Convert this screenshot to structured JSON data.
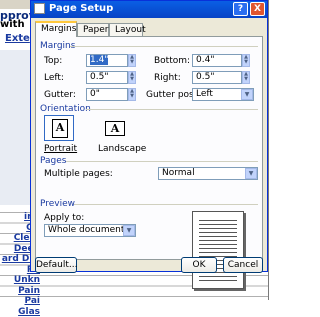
{
  "background": {
    "title_left": "pprova",
    "title_right": "s",
    "subtitle_left": "Exte",
    "subtitle_left_prefix": "with",
    "row_labels": [
      "irls",
      "Oil",
      "Clear",
      "Deep",
      "ard Dro",
      "Ro",
      "Unkn",
      "Pain",
      "Pai",
      "Glas"
    ]
  },
  "dialog": {
    "title": "Page Setup",
    "help_button": "?",
    "close_button": "X",
    "tabs": [
      {
        "label": "Margins",
        "selected": true
      },
      {
        "label": "Paper",
        "selected": false
      },
      {
        "label": "Layout",
        "selected": false
      }
    ],
    "margins": {
      "section_label": "Margins",
      "top_label": "Top:",
      "top_value": "1.4\"",
      "bottom_label": "Bottom:",
      "bottom_value": "0.4\"",
      "left_label": "Left:",
      "left_value": "0.5\"",
      "right_label": "Right:",
      "right_value": "0.5\"",
      "gutter_label": "Gutter:",
      "gutter_value": "0\"",
      "gutter_position_label": "Gutter position:",
      "gutter_position_value": "Left"
    },
    "orientation": {
      "section_label": "Orientation",
      "portrait_label": "Portrait",
      "landscape_label": "Landscape",
      "selected": "Portrait"
    },
    "pages": {
      "section_label": "Pages",
      "multiple_pages_label": "Multiple pages:",
      "multiple_pages_value": "Normal"
    },
    "preview": {
      "section_label": "Preview",
      "apply_to_label": "Apply to:",
      "apply_to_value": "Whole document"
    },
    "buttons": {
      "default": "Default...",
      "ok": "OK",
      "cancel": "Cancel"
    }
  }
}
